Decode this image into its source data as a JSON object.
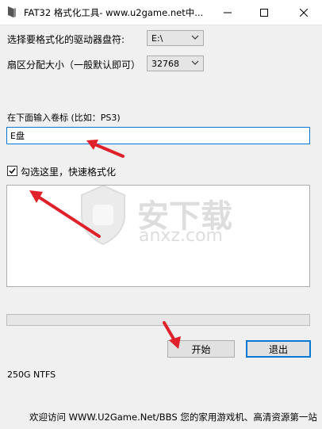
{
  "window": {
    "title": "FAT32 格式化工具- www.u2game.net中..."
  },
  "form": {
    "drive_label": "选择要格式化的驱动器盘符:",
    "drive_value": "E:\\",
    "sector_label": "扇区分配大小（一般默认即可）",
    "sector_value": "32768",
    "volume_label": "在下面输入卷标 (比如：PS3)",
    "volume_value": "E盘",
    "quick_format_label": "勾选这里，快速格式化",
    "quick_format_checked": true
  },
  "buttons": {
    "start": "开始",
    "exit": "退出"
  },
  "progress": {
    "value": 0
  },
  "status": {
    "info": "250G NTFS"
  },
  "footer": {
    "text": "欢迎访问 WWW.U2Game.Net/BBS 您的家用游戏机、高清资源第一站"
  },
  "watermark": {
    "brand": "安下载",
    "url": "anxz.com"
  },
  "colors": {
    "accent": "#0078d7",
    "annotation_arrow": "#e0202a"
  }
}
